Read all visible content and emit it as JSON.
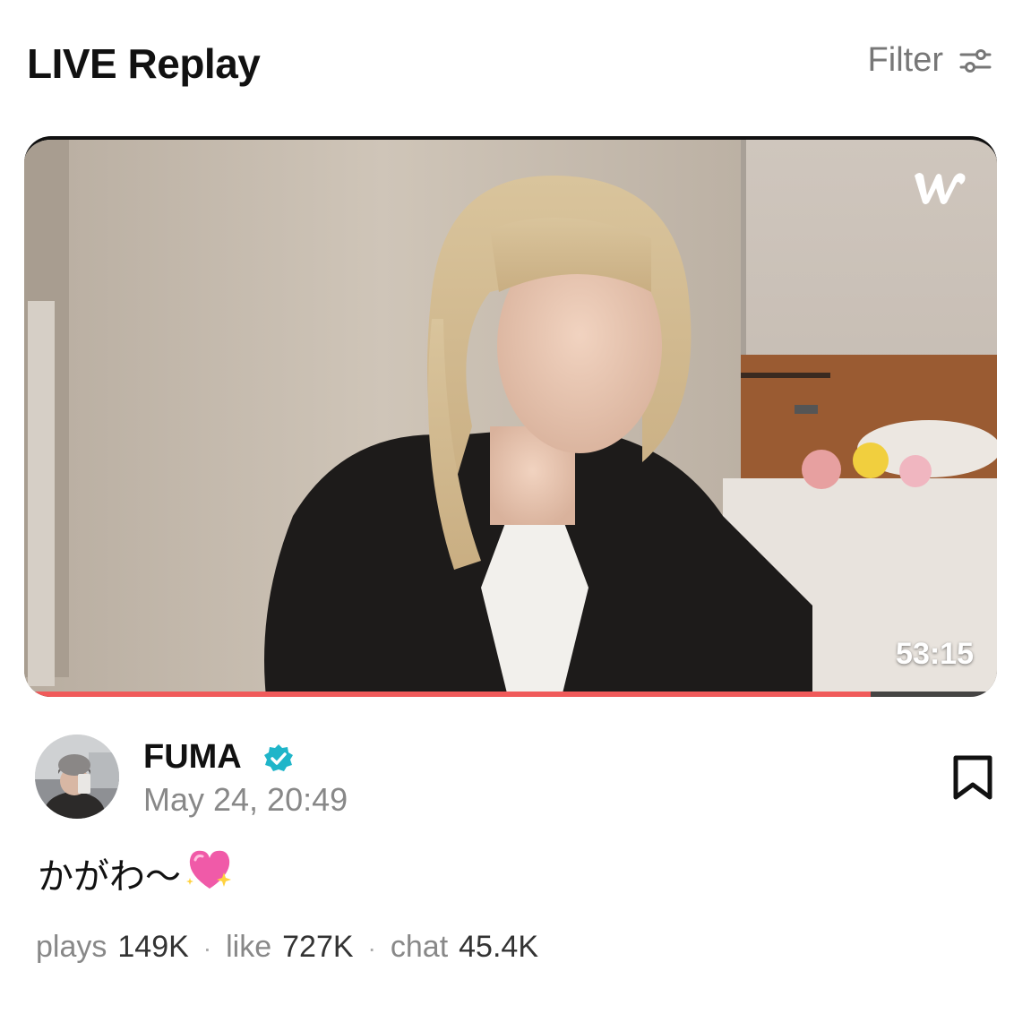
{
  "header": {
    "title": "LIVE Replay",
    "filter_label": "Filter"
  },
  "video": {
    "duration": "53:15",
    "progress": 0.87,
    "brand_icon": "w-logo-icon"
  },
  "author": {
    "name": "FUMA",
    "verified": true,
    "date": "May 24, 20:49"
  },
  "caption": {
    "text": "かがわ〜",
    "emoji": "sparkling-heart-icon"
  },
  "stats": [
    {
      "label": "plays",
      "value": "149K"
    },
    {
      "label": "like",
      "value": "727K"
    },
    {
      "label": "chat",
      "value": "45.4K"
    }
  ],
  "colors": {
    "progress": "#f05a5a",
    "verified": "#1fb5c9"
  }
}
